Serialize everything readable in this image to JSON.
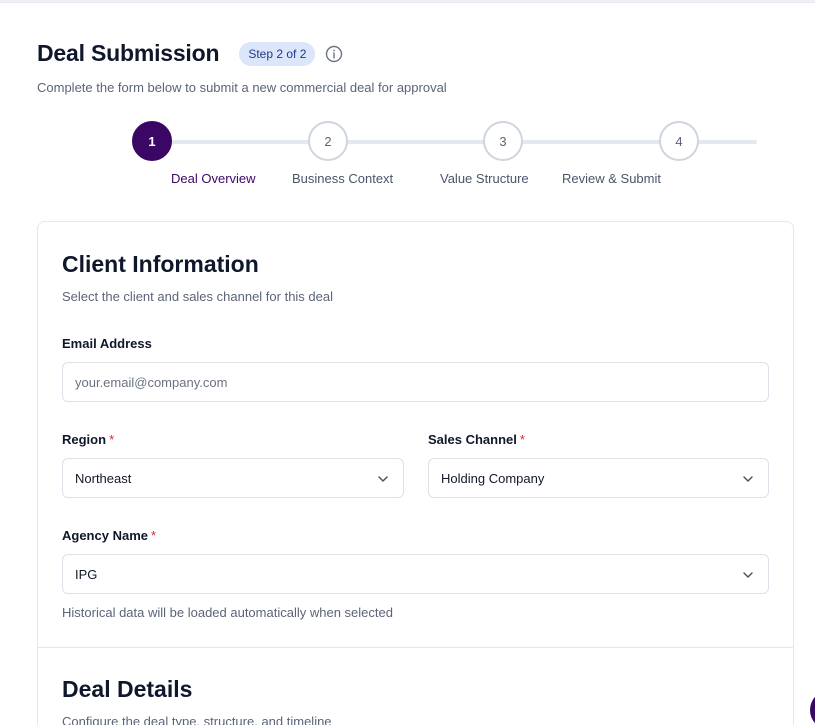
{
  "header": {
    "title": "Deal Submission",
    "step_badge": "Step 2 of 2",
    "subtitle": "Complete the form below to submit a new commercial deal for approval"
  },
  "stepper": {
    "steps": [
      {
        "number": "1",
        "label": "Deal Overview",
        "active": true
      },
      {
        "number": "2",
        "label": "Business Context",
        "active": false
      },
      {
        "number": "3",
        "label": "Value Structure",
        "active": false
      },
      {
        "number": "4",
        "label": "Review & Submit",
        "active": false
      }
    ]
  },
  "client_section": {
    "title": "Client Information",
    "subtitle": "Select the client and sales channel for this deal",
    "email": {
      "label": "Email Address",
      "placeholder": "your.email@company.com",
      "value": ""
    },
    "region": {
      "label": "Region",
      "required_mark": "*",
      "value": "Northeast"
    },
    "sales_channel": {
      "label": "Sales Channel",
      "required_mark": "*",
      "value": "Holding Company"
    },
    "agency": {
      "label": "Agency Name",
      "required_mark": "*",
      "value": "IPG",
      "help": "Historical data will be loaded automatically when selected"
    }
  },
  "deal_section": {
    "title": "Deal Details",
    "subtitle": "Configure the deal type, structure, and timeline"
  },
  "colors": {
    "accent": "#3b0764",
    "badge_bg": "#dbe6fb",
    "required": "#dc2626"
  },
  "icons": {
    "info": "info-icon",
    "dropdown": "chevron-down-icon"
  }
}
